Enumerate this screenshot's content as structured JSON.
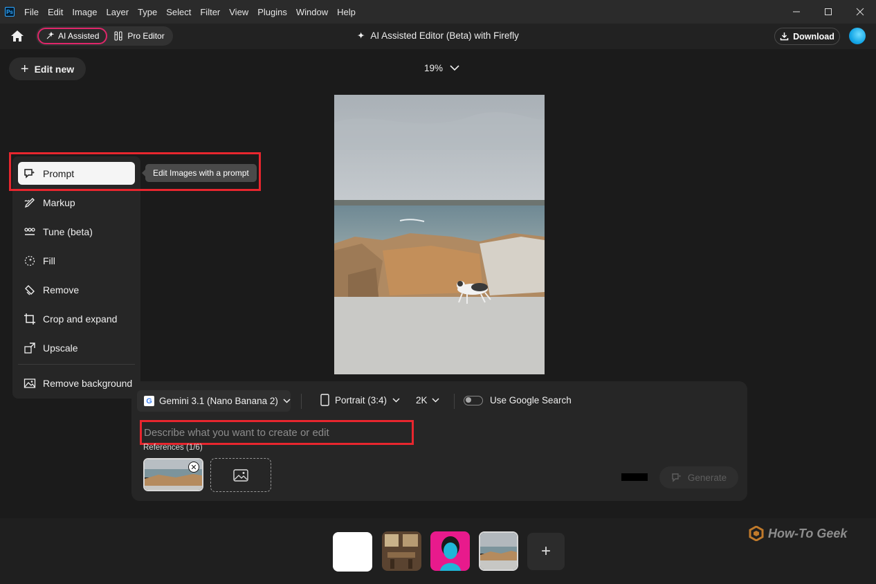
{
  "menubar": {
    "logo": "Ps",
    "items": [
      "File",
      "Edit",
      "Image",
      "Layer",
      "Type",
      "Select",
      "Filter",
      "View",
      "Plugins",
      "Window",
      "Help"
    ]
  },
  "toolbar": {
    "ai_assisted_label": "AI Assisted",
    "pro_editor_label": "Pro Editor",
    "title": "AI Assisted Editor (Beta) with Firefly",
    "download_label": "Download"
  },
  "edit_new_label": "Edit new",
  "zoom_level": "19%",
  "tools": [
    {
      "label": "Prompt",
      "icon": "prompt-icon"
    },
    {
      "label": "Markup",
      "icon": "markup-icon"
    },
    {
      "label": "Tune (beta)",
      "icon": "tune-icon"
    },
    {
      "label": "Fill",
      "icon": "fill-icon"
    },
    {
      "label": "Remove",
      "icon": "remove-icon"
    },
    {
      "label": "Crop and expand",
      "icon": "crop-icon"
    },
    {
      "label": "Upscale",
      "icon": "upscale-icon"
    },
    {
      "label": "Remove background",
      "icon": "remove-background-icon"
    }
  ],
  "tooltip": "Edit Images with a prompt",
  "prompt_panel": {
    "model": "Gemini 3.1 (Nano Banana 2)",
    "aspect": "Portrait (3:4)",
    "resolution": "2K",
    "google_search_label": "Use Google Search",
    "placeholder": "Describe what you want to create or edit",
    "references_label": "References (1/6)",
    "generate_label": "Generate"
  },
  "watermark": "How-To Geek",
  "colors": {
    "highlight": "#e8262e",
    "accent_ai": "#e0266a",
    "avatar": "#14a6e6"
  }
}
